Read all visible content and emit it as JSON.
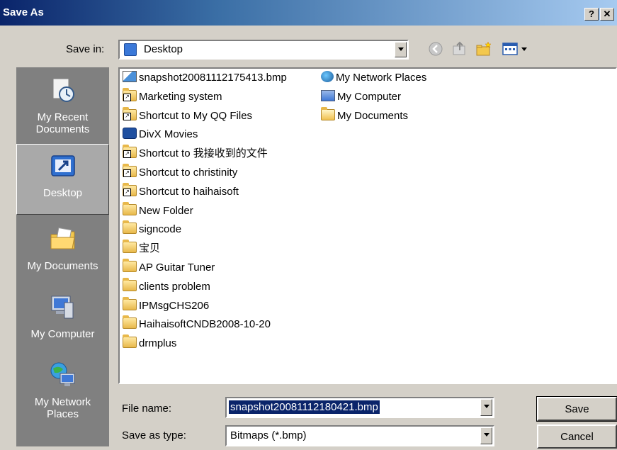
{
  "window": {
    "title": "Save As",
    "help_btn": "?",
    "close_btn": "✕"
  },
  "toolbar": {
    "save_in_label": "Save in:",
    "save_in_value": "Desktop"
  },
  "places": [
    {
      "label": "My Recent Documents"
    },
    {
      "label": "Desktop"
    },
    {
      "label": "My Documents"
    },
    {
      "label": "My Computer"
    },
    {
      "label": "My Network Places"
    }
  ],
  "files_col1": [
    {
      "name": "snapshot20081112175413.bmp",
      "icon": "bitmap-icon"
    },
    {
      "name": "Marketing system",
      "icon": "folder-shortcut-icon"
    },
    {
      "name": "Shortcut to My QQ Files",
      "icon": "folder-shortcut-icon"
    },
    {
      "name": "DivX Movies",
      "icon": "divx-icon"
    },
    {
      "name": "Shortcut to 我接收到的文件",
      "icon": "folder-shortcut-icon"
    },
    {
      "name": "Shortcut to christinity",
      "icon": "folder-shortcut-icon"
    },
    {
      "name": "Shortcut to haihaisoft",
      "icon": "folder-shortcut-icon"
    },
    {
      "name": "New Folder",
      "icon": "folder-icon"
    },
    {
      "name": "signcode",
      "icon": "folder-icon"
    },
    {
      "name": "宝贝",
      "icon": "folder-icon"
    },
    {
      "name": "AP Guitar Tuner",
      "icon": "folder-icon"
    },
    {
      "name": "clients problem",
      "icon": "folder-icon"
    },
    {
      "name": "IPMsgCHS206",
      "icon": "folder-icon"
    },
    {
      "name": "HaihaisoftCNDB2008-10-20",
      "icon": "folder-icon"
    },
    {
      "name": "drmplus",
      "icon": "folder-icon"
    }
  ],
  "files_col2": [
    {
      "name": "My Network Places",
      "icon": "network-icon"
    },
    {
      "name": "My Computer",
      "icon": "computer-icon"
    },
    {
      "name": "My Documents",
      "icon": "documents-folder-icon"
    }
  ],
  "form": {
    "file_name_label": "File name:",
    "file_name_value": "snapshot20081112180421.bmp",
    "type_label": "Save as type:",
    "type_value": "Bitmaps (*.bmp)"
  },
  "buttons": {
    "save": "Save",
    "cancel": "Cancel"
  },
  "colors": {
    "title_start": "#0a246a",
    "title_end": "#a6caf0",
    "face": "#d4d0c8",
    "places_bg": "#808080",
    "selection": "#0a246a"
  }
}
